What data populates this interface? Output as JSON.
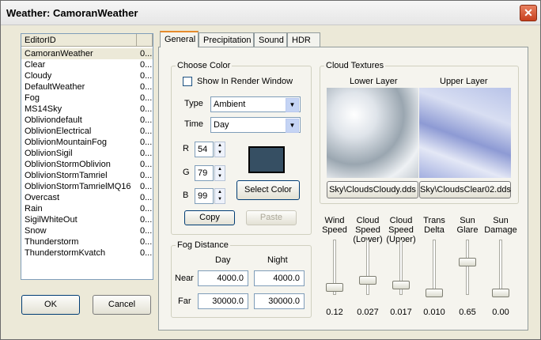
{
  "window": {
    "title": "Weather: CamoranWeather",
    "close_symbol": "✕"
  },
  "list": {
    "header": "EditorID",
    "items": [
      {
        "id": "CamoranWeather",
        "val": "0..."
      },
      {
        "id": "Clear",
        "val": "0..."
      },
      {
        "id": "Cloudy",
        "val": "0..."
      },
      {
        "id": "DefaultWeather",
        "val": "0..."
      },
      {
        "id": "Fog",
        "val": "0..."
      },
      {
        "id": "MS14Sky",
        "val": "0..."
      },
      {
        "id": "Obliviondefault",
        "val": "0..."
      },
      {
        "id": "OblivionElectrical",
        "val": "0..."
      },
      {
        "id": "OblivionMountainFog",
        "val": "0..."
      },
      {
        "id": "OblivionSigil",
        "val": "0..."
      },
      {
        "id": "OblivionStormOblivion",
        "val": "0..."
      },
      {
        "id": "OblivionStormTamriel",
        "val": "0..."
      },
      {
        "id": "OblivionStormTamrielMQ16",
        "val": "0..."
      },
      {
        "id": "Overcast",
        "val": "0..."
      },
      {
        "id": "Rain",
        "val": "0..."
      },
      {
        "id": "SigilWhiteOut",
        "val": "0..."
      },
      {
        "id": "Snow",
        "val": "0..."
      },
      {
        "id": "Thunderstorm",
        "val": "0..."
      },
      {
        "id": "ThunderstormKvatch",
        "val": "0..."
      }
    ]
  },
  "buttons": {
    "ok": "OK",
    "cancel": "Cancel"
  },
  "tabs": [
    "General",
    "Precipitation",
    "Sound",
    "HDR"
  ],
  "choose_color": {
    "label": "Choose Color",
    "show_in_render": "Show In Render Window",
    "type_label": "Type",
    "type_value": "Ambient",
    "time_label": "Time",
    "time_value": "Day",
    "r_label": "R",
    "r": "54",
    "g_label": "G",
    "g": "79",
    "b_label": "B",
    "b": "99",
    "swatch_color": "#364f63",
    "select_color": "Select Color",
    "copy": "Copy",
    "paste": "Paste"
  },
  "fog": {
    "label": "Fog Distance",
    "day": "Day",
    "night": "Night",
    "near_label": "Near",
    "near_day": "4000.0",
    "near_night": "4000.0",
    "far_label": "Far",
    "far_day": "30000.0",
    "far_night": "30000.0"
  },
  "clouds": {
    "label": "Cloud Textures",
    "lower": "Lower Layer",
    "upper": "Upper Layer",
    "lower_file": "Sky\\CloudsCloudy.dds",
    "upper_file": "Sky\\CloudsClear02.dds"
  },
  "sliders": [
    {
      "l1": "Wind",
      "l2": "Speed",
      "l3": "",
      "value": "0.12",
      "level": 0.12
    },
    {
      "l1": "Cloud",
      "l2": "Speed",
      "l3": "(Lower)",
      "value": "0.027",
      "level": 0.27
    },
    {
      "l1": "Cloud",
      "l2": "Speed",
      "l3": "(Upper)",
      "value": "0.017",
      "level": 0.17
    },
    {
      "l1": "Trans",
      "l2": "Delta",
      "l3": "",
      "value": "0.010",
      "level": 0.0
    },
    {
      "l1": "Sun",
      "l2": "Glare",
      "l3": "",
      "value": "0.65",
      "level": 0.65
    },
    {
      "l1": "Sun",
      "l2": "Damage",
      "l3": "",
      "value": "0.00",
      "level": 0.0
    }
  ]
}
